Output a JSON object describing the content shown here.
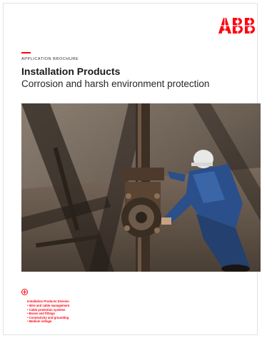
{
  "brand": {
    "logo_text": "ABB",
    "accent_color": "#ff000f"
  },
  "header": {
    "overline": "APPLICATION BROCHURE",
    "title": "Installation Products",
    "subtitle": "Corrosion and harsh environment protection"
  },
  "photo": {
    "description_icon": "oil-rig-worker-photo"
  },
  "division": {
    "icon": "plus-circle-icon",
    "title": "Installation Products Division",
    "items": [
      "Wire and cable management",
      "Cable protection systems",
      "Boxes and fittings",
      "Connectivity and grounding",
      "Medium voltage"
    ]
  }
}
